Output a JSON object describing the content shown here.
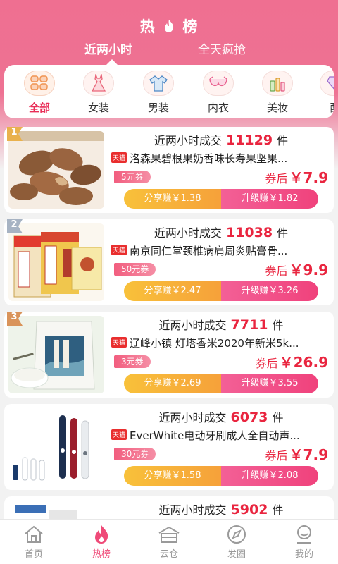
{
  "header": {
    "title_left": "热",
    "title_right": "榜",
    "tabs": [
      {
        "label": "近两小时"
      },
      {
        "label": "全天疯抢"
      }
    ]
  },
  "categories": [
    {
      "label": "全部",
      "icon": "grid-icon"
    },
    {
      "label": "女装",
      "icon": "dress-icon"
    },
    {
      "label": "男装",
      "icon": "shirt-icon"
    },
    {
      "label": "内衣",
      "icon": "bra-icon"
    },
    {
      "label": "美妆",
      "icon": "cosmetics-icon"
    },
    {
      "label": "配",
      "icon": "jewelry-icon"
    }
  ],
  "products": [
    {
      "rank": "1",
      "deal_prefix": "近两小时成交",
      "deal_count": "11129",
      "deal_unit": "件",
      "badge": "天猫",
      "name": "洛森果碧根果奶香味长寿果坚果...",
      "coupon": "5元券",
      "after_label": "券后",
      "price": "￥7.9",
      "share": "分享赚￥1.38",
      "upgrade": "升级赚￥1.82"
    },
    {
      "rank": "2",
      "deal_prefix": "近两小时成交",
      "deal_count": "11038",
      "deal_unit": "件",
      "badge": "天猫",
      "name": "南京同仁堂颈椎病肩周炎贴膏骨...",
      "coupon": "50元券",
      "after_label": "券后",
      "price": "￥9.9",
      "share": "分享赚￥2.47",
      "upgrade": "升级赚￥3.26"
    },
    {
      "rank": "3",
      "deal_prefix": "近两小时成交",
      "deal_count": "7711",
      "deal_unit": "件",
      "badge": "天猫",
      "name": "辽峰小镇 灯塔香米2020年新米5k...",
      "coupon": "3元券",
      "after_label": "券后",
      "price": "￥26.9",
      "share": "分享赚￥2.69",
      "upgrade": "升级赚￥3.55"
    },
    {
      "rank": "",
      "deal_prefix": "近两小时成交",
      "deal_count": "6073",
      "deal_unit": "件",
      "badge": "天猫",
      "name": "EverWhite电动牙刷成人全自动声...",
      "coupon": "30元券",
      "after_label": "券后",
      "price": "￥7.9",
      "share": "分享赚￥1.58",
      "upgrade": "升级赚￥2.08"
    },
    {
      "rank": "",
      "deal_prefix": "近两小时成交",
      "deal_count": "5902",
      "deal_unit": "件"
    }
  ],
  "bottom_nav": [
    {
      "label": "首页",
      "icon": "home-icon"
    },
    {
      "label": "热榜",
      "icon": "flame-icon"
    },
    {
      "label": "云仓",
      "icon": "warehouse-icon"
    },
    {
      "label": "发圈",
      "icon": "compass-icon"
    },
    {
      "label": "我的",
      "icon": "profile-icon"
    }
  ],
  "colors": {
    "brand_pink": "#ef6f91",
    "price_red": "#e9253f",
    "share_orange": "#f6a13a",
    "upgrade_pink": "#f0427c"
  }
}
